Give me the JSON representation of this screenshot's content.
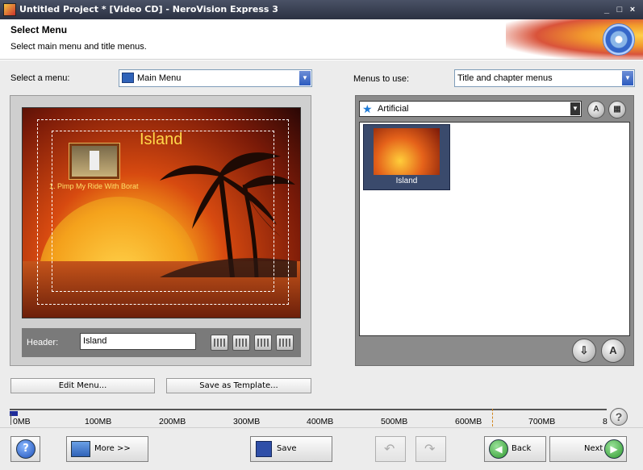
{
  "window": {
    "title": "Untitled Project * [Video CD] - NeroVision Express 3",
    "controls": [
      "_",
      "□",
      "×"
    ]
  },
  "header": {
    "title": "Select Menu",
    "subtitle": "Select main menu and title menus."
  },
  "left": {
    "select_label": "Select a menu:",
    "select_value": "Main Menu",
    "preview": {
      "menu_title": "Island",
      "chapter_label": "1. Pimp My Ride With Borat"
    },
    "header_label": "Header:",
    "header_value": "Island",
    "edit_menu": "Edit Menu...",
    "save_template": "Save as Template..."
  },
  "right": {
    "menus_label": "Menus to use:",
    "menus_value": "Title and chapter menus",
    "theme_value": "Artificial",
    "items": [
      {
        "label": "Island",
        "selected": true
      }
    ],
    "thumb_title": "Island"
  },
  "capacity": {
    "ticks": [
      "0MB",
      "100MB",
      "200MB",
      "300MB",
      "400MB",
      "500MB",
      "600MB",
      "700MB",
      "8"
    ]
  },
  "bottom": {
    "more": "More >>",
    "save": "Save",
    "back": "Back",
    "next": "Next"
  },
  "colors": {
    "accent_blue": "#2c5bbf",
    "nav_green": "#2f9a2f",
    "title_yellow": "#ffd84a"
  }
}
